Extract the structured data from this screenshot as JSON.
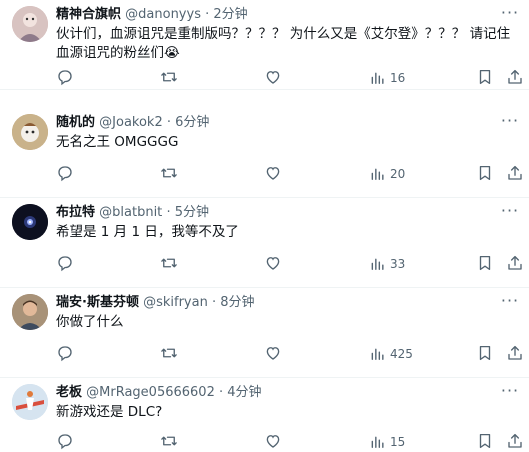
{
  "tweets": [
    {
      "name": "精神合旗帜",
      "handle": "@danonyys",
      "dot": "·",
      "time": "2分钟",
      "text": "伙计们，血源诅咒是重制版吗？？？？ 为什么又是《艾尔登》？？？ 请记住血源诅咒的粉丝们😭",
      "views": "16",
      "avatar_color": "#c9a9a6"
    },
    {
      "name": "随机的",
      "handle": "@Joakok2",
      "dot": "·",
      "time": "6分钟",
      "text": "无名之王 OMGGGG",
      "views": "20",
      "avatar_color": "#b89a6a"
    },
    {
      "name": "布拉特",
      "handle": "@blatbnit",
      "dot": "·",
      "time": "5分钟",
      "text": "希望是 1 月 1 日，我等不及了",
      "views": "33",
      "avatar_color": "#101320"
    },
    {
      "name": "瑞安·斯基芬顿",
      "handle": "@skifryan",
      "dot": "·",
      "time": "8分钟",
      "text": "你做了什么",
      "views": "425",
      "avatar_color": "#8a6f55"
    },
    {
      "name": "老板",
      "handle": "@MrRage05666602",
      "dot": "·",
      "time": "4分钟",
      "text": "新游戏还是 DLC?",
      "views": "15",
      "avatar_color": "#c7d7e6"
    }
  ],
  "icons": {
    "more": "more-icon",
    "reply": "reply-icon",
    "repost": "repost-icon",
    "like": "like-icon",
    "views": "views-icon",
    "bookmark": "bookmark-icon",
    "share": "share-icon"
  },
  "colors": {
    "text": "#0f1419",
    "secondary": "#536471",
    "border": "#eff3f4"
  }
}
